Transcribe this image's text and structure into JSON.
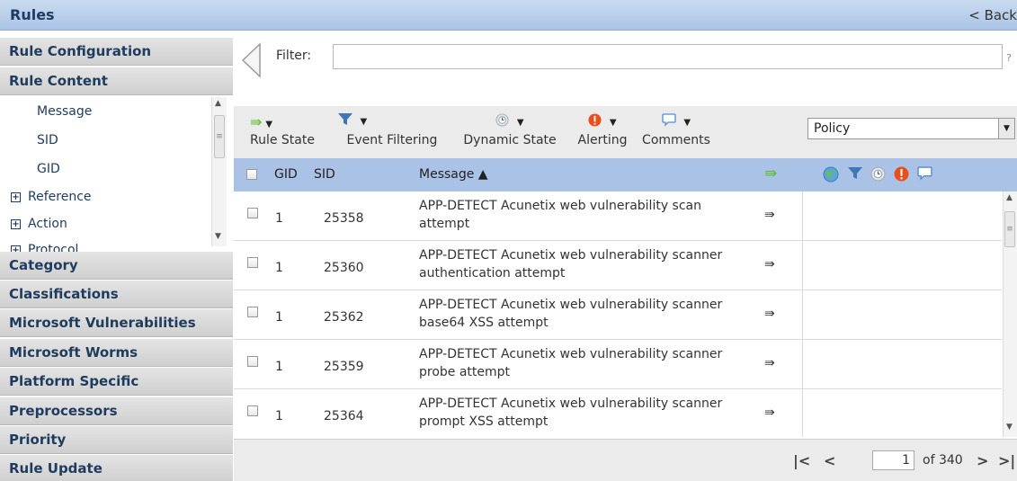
{
  "titlebar": {
    "title": "Rules",
    "back_label": "< Back"
  },
  "sidebar": {
    "categories_top": [
      "Rule Configuration",
      "Rule Content"
    ],
    "content_items": [
      "Message",
      "SID",
      "GID"
    ],
    "content_tree_items": [
      "Reference",
      "Action",
      "Protocol"
    ],
    "categories_bottom": [
      "Category",
      "Classifications",
      "Microsoft Vulnerabilities",
      "Microsoft Worms",
      "Platform Specific",
      "Preprocessors",
      "Priority",
      "Rule Update"
    ]
  },
  "filter": {
    "label": "Filter:",
    "value": "",
    "help": "?"
  },
  "toolbar": {
    "rule_state": "Rule State",
    "event_filtering": "Event Filtering",
    "dynamic_state": "Dynamic State",
    "alerting": "Alerting",
    "comments": "Comments",
    "policy_value": "Policy"
  },
  "table": {
    "headers": {
      "gid": "GID",
      "sid": "SID",
      "message": "Message ▲"
    },
    "rows": [
      {
        "gid": "1",
        "sid": "25358",
        "message": "APP-DETECT Acunetix web vulnerability scan attempt"
      },
      {
        "gid": "1",
        "sid": "25360",
        "message": "APP-DETECT Acunetix web vulnerability scanner authentication attempt"
      },
      {
        "gid": "1",
        "sid": "25362",
        "message": "APP-DETECT Acunetix web vulnerability scanner base64 XSS attempt"
      },
      {
        "gid": "1",
        "sid": "25359",
        "message": "APP-DETECT Acunetix web vulnerability scanner probe attempt"
      },
      {
        "gid": "1",
        "sid": "25364",
        "message": "APP-DETECT Acunetix web vulnerability scanner prompt XSS attempt"
      }
    ]
  },
  "pager": {
    "current_page": "1",
    "of_label": "of 340"
  },
  "colors": {
    "accent": "#aac4e6",
    "header": "#a9c2e5",
    "green_arrow": "#9fd37a"
  }
}
